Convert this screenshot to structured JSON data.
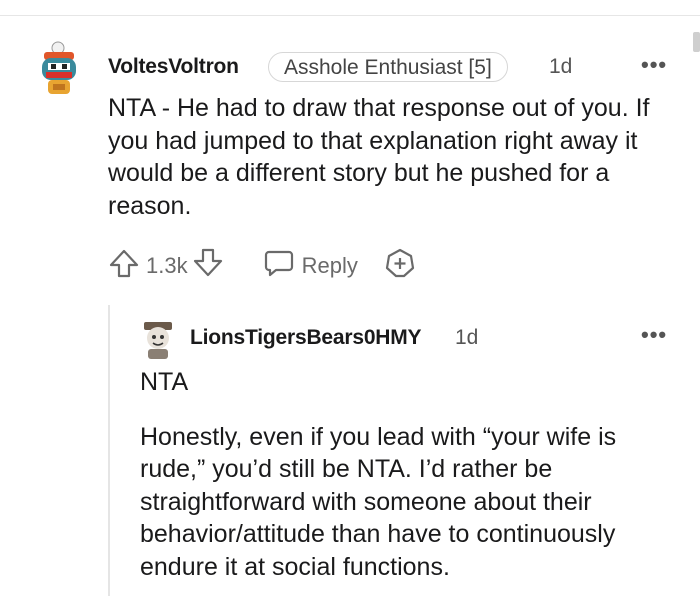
{
  "comments": [
    {
      "username": "VoltesVoltron",
      "flair": "Asshole Enthusiast [5]",
      "time": "1d",
      "paragraphs": [
        "NTA - He had to draw that response out of you. If you had jumped to that explanation right away it would be a different story but he pushed for a reason."
      ],
      "votes": "1.3k",
      "reply_label": "Reply"
    },
    {
      "username": "LionsTigersBears0HMY",
      "time": "1d",
      "paragraphs": [
        "NTA",
        "Honestly, even if you lead with “your wife is rude,” you’d still be NTA. I’d rather be straightforward with someone about their behavior/attitude than have to continuously endure it at social functions."
      ]
    }
  ],
  "icons": {
    "more": "more-options-icon",
    "upvote": "upvote-arrow-icon",
    "downvote": "downvote-arrow-icon",
    "reply": "speech-bubble-icon",
    "award": "award-plus-icon"
  },
  "colors": {
    "text": "#1a1a1b",
    "muted": "#6a6a6a",
    "divider": "#e5e5e5"
  }
}
